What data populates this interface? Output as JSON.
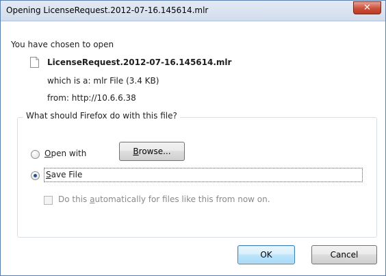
{
  "window": {
    "title": "Opening LicenseRequest.2012-07-16.145614.mlr",
    "close_glyph": "✕"
  },
  "dialog": {
    "chosen_label": "You have chosen to open",
    "filename": "LicenseRequest.2012-07-16.145614.mlr",
    "file_icon": "document-icon",
    "type_prefix": "which is a:",
    "type_value": "mlr File (3.4 KB)",
    "from_prefix": "from:",
    "from_value": "http://10.6.6.38"
  },
  "action_group": {
    "legend": "What should Firefox do with this file?",
    "open_with_first": "O",
    "open_with_rest": "pen with",
    "browse_first": "B",
    "browse_rest": "rowse...",
    "save_file_first": "S",
    "save_file_rest": "ave File",
    "selected_option": "save_file",
    "auto_before": "Do this ",
    "auto_underlined": "a",
    "auto_after": "utomatically for files like this from now on.",
    "auto_checked": false
  },
  "buttons": {
    "ok": "OK",
    "cancel": "Cancel"
  },
  "colors": {
    "titlebar": "#d2ddec",
    "close_button": "#c9503a",
    "radio_dot": "#234f90",
    "default_button_border": "#3c7fb1"
  }
}
